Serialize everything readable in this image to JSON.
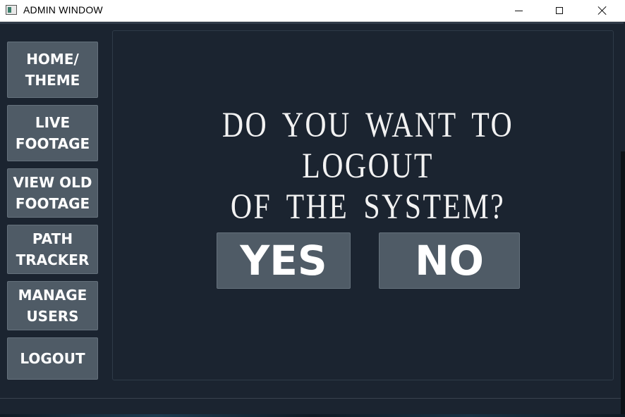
{
  "window": {
    "title": "ADMIN WINDOW",
    "controls": {
      "minimize_icon": "minimize-icon",
      "maximize_icon": "maximize-icon",
      "close_icon": "close-icon"
    }
  },
  "sidebar": {
    "items": [
      {
        "line1": "HOME/",
        "line2": "THEME"
      },
      {
        "line1": "LIVE",
        "line2": "FOOTAGE"
      },
      {
        "line1": "VIEW OLD",
        "line2": "FOOTAGE"
      },
      {
        "line1": "PATH",
        "line2": "TRACKER"
      },
      {
        "line1": "MANAGE",
        "line2": "USERS"
      },
      {
        "line1": "LOGOUT",
        "line2": ""
      }
    ]
  },
  "dialog": {
    "question_line1": "DO YOU WANT TO LOGOUT",
    "question_line2": "OF THE SYSTEM?",
    "yes_label": "YES",
    "no_label": "NO"
  },
  "colors": {
    "background": "#1b2430",
    "button": "#4f5b66",
    "text": "#ffffff",
    "titlebar": "#ffffff"
  }
}
